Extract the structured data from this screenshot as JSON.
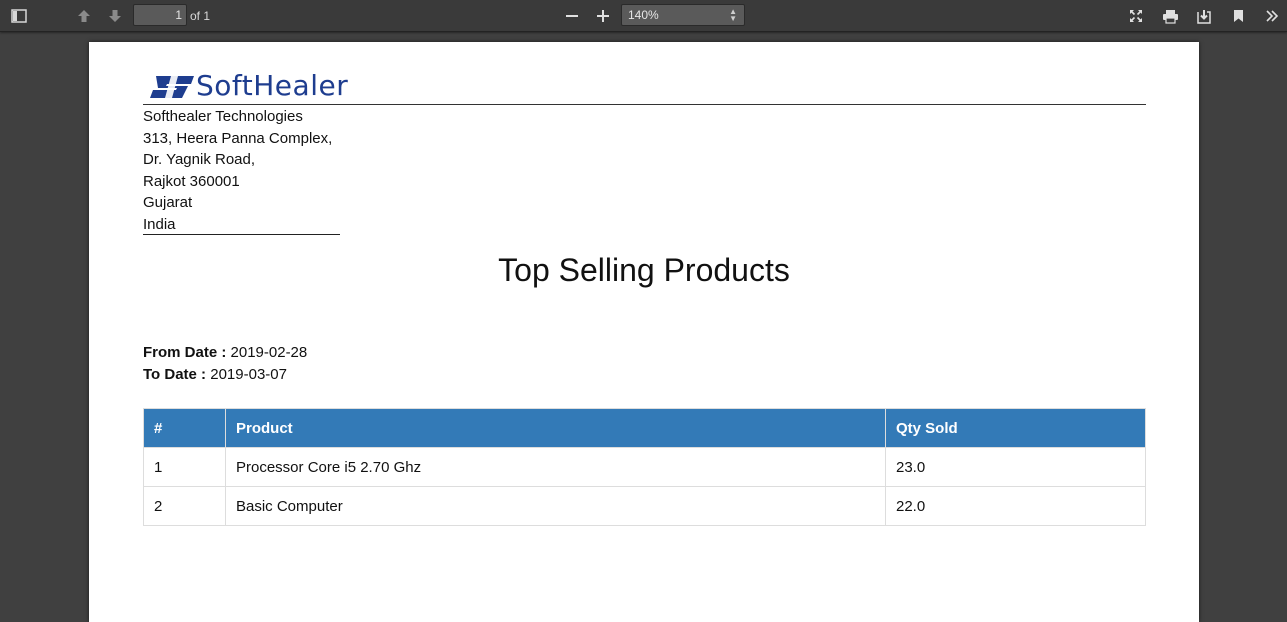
{
  "viewer": {
    "page_number": "1",
    "page_of": "of 1",
    "zoom": "140%"
  },
  "company": {
    "logo_text": "SoftHealer",
    "name": "Softhealer Technologies",
    "address_lines": [
      "313, Heera Panna Complex,",
      "Dr. Yagnik Road,",
      "Rajkot 360001",
      "Gujarat",
      "India"
    ],
    "brand_color": "#1e3d8f"
  },
  "report": {
    "title": "Top Selling Products",
    "from_label": "From Date :",
    "from_value": "2019-02-28",
    "to_label": "To Date :",
    "to_value": "2019-03-07",
    "header_color": "#337ab7",
    "columns": [
      "#",
      "Product",
      "Qty Sold"
    ],
    "rows": [
      [
        "1",
        "Processor Core i5 2.70 Ghz",
        "23.0"
      ],
      [
        "2",
        "Basic Computer",
        "22.0"
      ]
    ]
  }
}
